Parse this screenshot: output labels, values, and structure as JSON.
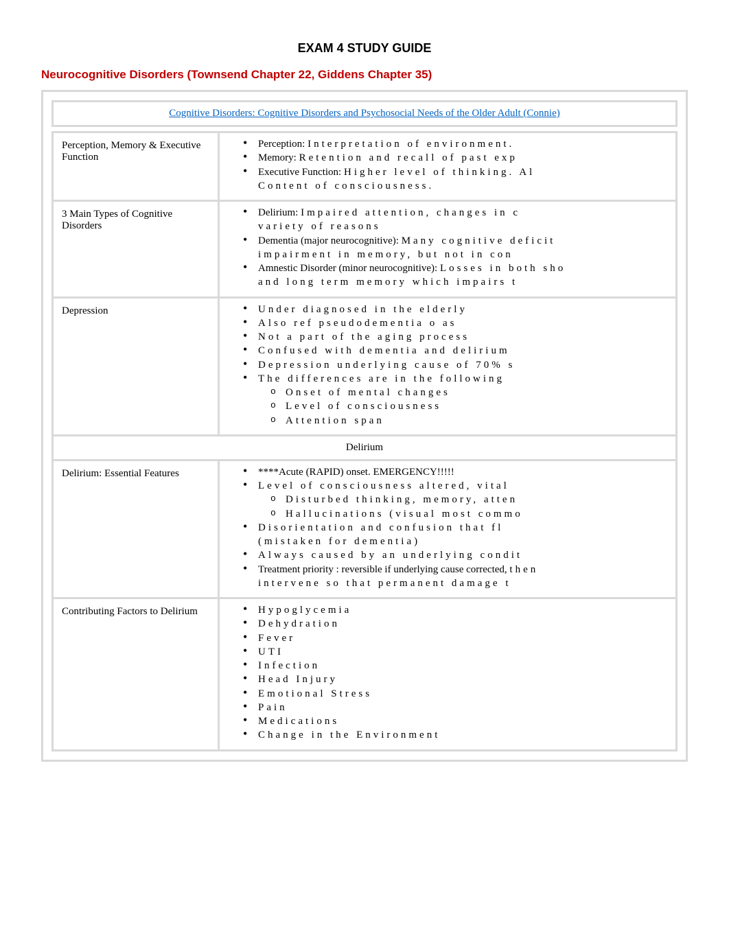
{
  "title": "EXAM 4 STUDY GUIDE",
  "section_heading": "Neurocognitive Disorders (Townsend Chapter 22, Giddens Chapter 35)",
  "link_header": "Cognitive Disorders: Cognitive Disorders and Psychosocial Needs of the Older Adult (Connie)",
  "rows": [
    {
      "label": "Perception, Memory & Executive Function",
      "items": [
        {
          "prefix": "Perception: ",
          "text": "Interpretation of environment."
        },
        {
          "prefix": "Memory: ",
          "text": "Retention and recall of past exp"
        },
        {
          "prefix": "Executive Function: ",
          "text": "Higher level of thinking. Al"
        },
        {
          "prefix": "",
          "text": "Content of consciousness.",
          "no_bullet": true
        }
      ]
    },
    {
      "label": "3 Main Types of Cognitive Disorders",
      "items": [
        {
          "prefix": "Delirium: ",
          "text": "Impaired attention, changes in c"
        },
        {
          "prefix": "",
          "text": "variety of reasons",
          "no_bullet": true
        },
        {
          "prefix": "Dementia (major neurocognitive):  ",
          "text": "Many cognitive deficit"
        },
        {
          "prefix": "",
          "text": "impairment in memory, but not in con",
          "no_bullet": true
        },
        {
          "prefix": "Amnestic Disorder (minor neurocognitive):  ",
          "text": "Losses in both sho"
        },
        {
          "prefix": "",
          "text": "and long term memory which impairs t",
          "no_bullet": true
        }
      ]
    },
    {
      "label": "Depression",
      "items": [
        {
          "text": "Under diagnosed in the elderly"
        },
        {
          "text": "Also ref pseudodementia o as"
        },
        {
          "text": "Not a part of the aging process"
        },
        {
          "text": "Confused with dementia and delirium"
        },
        {
          "text": "Depression underlying cause of 70% s"
        },
        {
          "text": "The differences are in the following",
          "sub": [
            "Onset of mental changes",
            "Level of consciousness",
            "Attention span"
          ]
        }
      ]
    }
  ],
  "subheader": "Delirium",
  "rows2": [
    {
      "label": "Delirium: Essential Features",
      "items": [
        {
          "prefix": "",
          "text_tight": "****Acute (RAPID) onset. EMERGENCY!!!!!"
        },
        {
          "text": "Level of consciousness altered, vital",
          "sub": [
            "Disturbed thinking, memory, atten",
            "Hallucinations (visual most commo"
          ]
        },
        {
          "text": "Disorientation and confusion that fl"
        },
        {
          "text": "(mistaken for dementia)",
          "no_bullet": true
        },
        {
          "text": "Always caused by an underlying condit"
        },
        {
          "prefix": "Treatment priority  : reversible if underlying cause corrected,  ",
          "text": "then"
        },
        {
          "text": "intervene so that permanent damage t",
          "no_bullet": true
        }
      ]
    },
    {
      "label": "Contributing Factors to Delirium",
      "items": [
        {
          "text": "Hypoglycemia"
        },
        {
          "text": "Dehydration"
        },
        {
          "text": "Fever"
        },
        {
          "text": "UTI"
        },
        {
          "text": "Infection"
        },
        {
          "text": "Head Injury"
        },
        {
          "text": "Emotional Stress"
        },
        {
          "text": "Pain"
        },
        {
          "text": "Medications"
        },
        {
          "text": "Change in the Environment"
        }
      ]
    }
  ]
}
